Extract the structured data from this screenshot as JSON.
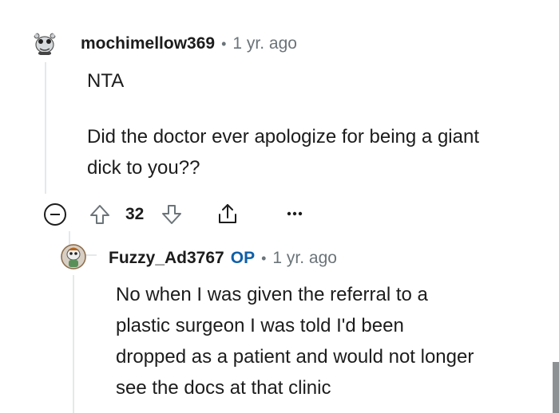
{
  "comments": [
    {
      "username": "mochimellow369",
      "separator": "•",
      "time": "1 yr. ago",
      "paragraphs": [
        "NTA",
        "Did the doctor ever apologize for being a giant dick to you??"
      ],
      "votes": "32",
      "avatar_icon": "snoo-avatar-icon"
    },
    {
      "username": "Fuzzy_Ad3767",
      "op_badge": "OP",
      "separator": "•",
      "time": "1 yr. ago",
      "text": "No when I was given the referral to a plastic surgeon I was told I'd been dropped as a patient and would not longer see the docs at that clinic",
      "avatar_icon": "snoo-avatar-icon"
    }
  ],
  "icons": {
    "collapse": "collapse-icon",
    "upvote": "upvote-arrow-icon",
    "downvote": "downvote-arrow-icon",
    "share": "share-icon",
    "more": "more-options-icon"
  }
}
